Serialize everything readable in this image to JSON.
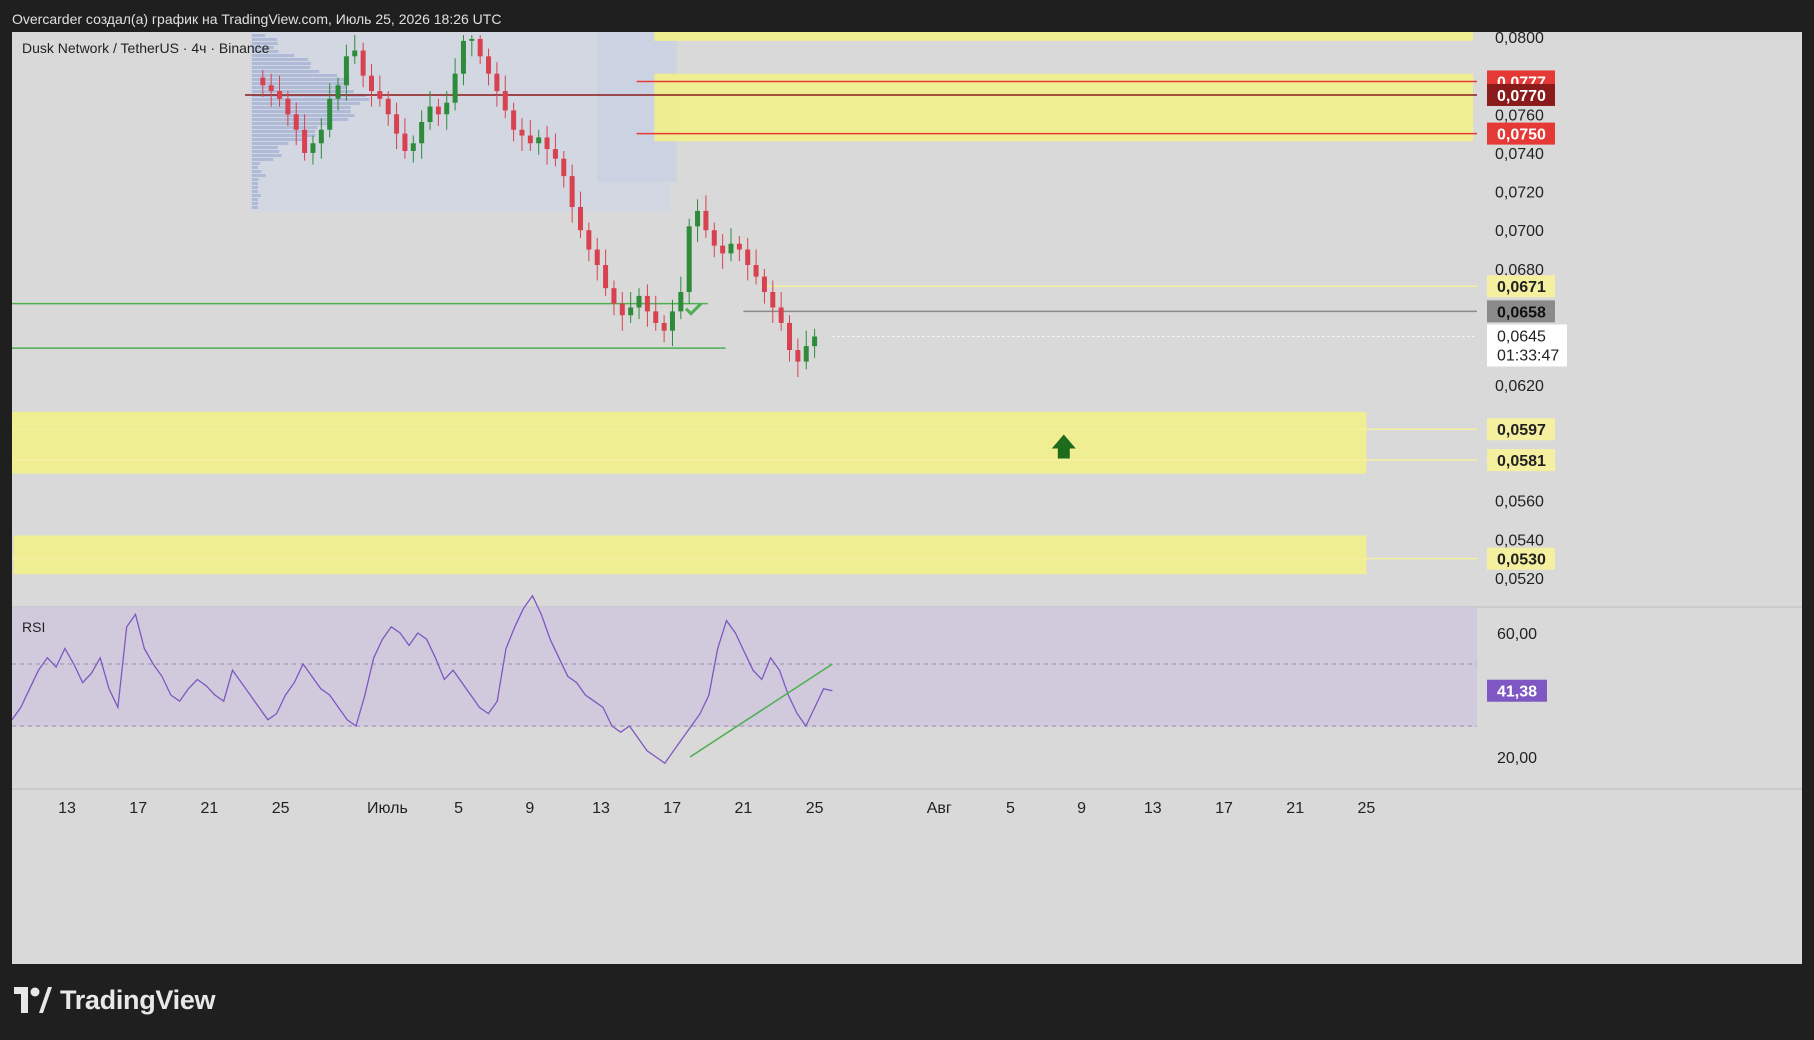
{
  "header": {
    "caption": "Overcarder создал(а) график на TradingView.com, Июль 25, 2026 18:26 UTC"
  },
  "symbol": {
    "title": "Dusk Network / TetherUS · 4ч · Binance"
  },
  "footer": {
    "brand": "TradingView"
  },
  "colors": {
    "background": "#1f1f1f",
    "chart_bg": "#d9d9d9",
    "zone": "#f2f08a",
    "up": "#2e8b3a",
    "down": "#d8414f",
    "rsi": "#7e57c2",
    "rsi_band": "#cfc8dc",
    "support_line": "#4caf50",
    "resistance_red": "#e53935",
    "resistance_dark": "#8b1a1a",
    "arrow": "#1e6b1e"
  },
  "icons": {
    "arrow": "arrow-up-icon",
    "check": "check-mark-icon",
    "logo": "tradingview-logo-icon"
  },
  "chart_data": {
    "type": "candlestick",
    "title": "Dusk Network / TetherUS · 4ч · Binance",
    "price_scale": {
      "ylim": [
        0.0508,
        0.0802
      ],
      "tick_labels": [
        "0,0800",
        "0,0760",
        "0,0740",
        "0,0720",
        "0,0700",
        "0,0680",
        "0,0620",
        "0,0560",
        "0,0540",
        "0,0520"
      ],
      "tick_values": [
        0.08,
        0.076,
        0.074,
        0.072,
        0.07,
        0.068,
        0.062,
        0.056,
        0.054,
        0.052
      ]
    },
    "time_axis": {
      "labels": [
        "13",
        "17",
        "21",
        "25",
        "Июль",
        "5",
        "9",
        "13",
        "17",
        "21",
        "25",
        "Авг",
        "5",
        "9",
        "13",
        "17",
        "21",
        "25"
      ]
    },
    "price_badges": [
      {
        "label": "0,0777",
        "value": 0.0777,
        "style": "red"
      },
      {
        "label": "0,0770",
        "value": 0.077,
        "style": "darkred"
      },
      {
        "label": "0,0750",
        "value": 0.075,
        "style": "red"
      },
      {
        "label": "0,0671",
        "value": 0.0671,
        "style": "yellow"
      },
      {
        "label": "0,0658",
        "value": 0.0658,
        "style": "gray"
      },
      {
        "label": "0,0597",
        "value": 0.0597,
        "style": "yellow"
      },
      {
        "label": "0,0581",
        "value": 0.0581,
        "style": "yellow"
      },
      {
        "label": "0,0530",
        "value": 0.053,
        "style": "yellow"
      }
    ],
    "last_price": {
      "label": "0,0645",
      "countdown": "01:33:47",
      "value": 0.0645
    },
    "zones": [
      {
        "name": "resistance-zone-top",
        "from": "2026-07-16",
        "to": "2026-08-31",
        "low": 0.0798,
        "high": 0.0803
      },
      {
        "name": "resistance-zone",
        "from": "2026-07-16",
        "to": "2026-08-31",
        "low": 0.0746,
        "high": 0.0781
      },
      {
        "name": "support-zone-upper",
        "from": "2026-06-09",
        "to": "2026-08-25",
        "low": 0.0574,
        "high": 0.0606
      },
      {
        "name": "support-zone-lower",
        "from": "2026-06-10",
        "to": "2026-08-25",
        "low": 0.0522,
        "high": 0.0542
      }
    ],
    "level_lines": [
      {
        "value": 0.0671,
        "color": "#f5f0a0",
        "from": "2026-07-22",
        "to": "end"
      },
      {
        "value": 0.0658,
        "color": "#8a8a8a",
        "from": "2026-07-21",
        "to": "end"
      },
      {
        "value": 0.0597,
        "color": "#f5f0a0",
        "from": "start",
        "to": "end"
      },
      {
        "value": 0.0581,
        "color": "#f5f0a0",
        "from": "start",
        "to": "end"
      },
      {
        "value": 0.053,
        "color": "#f5f0a0",
        "from": "start",
        "to": "end"
      },
      {
        "value": 0.077,
        "color": "#8b1a1a",
        "from": "2026-06-23",
        "to": "end"
      },
      {
        "value": 0.0777,
        "color": "#e53935",
        "from": "2026-07-15",
        "to": "end"
      },
      {
        "value": 0.075,
        "color": "#e53935",
        "from": "2026-07-15",
        "to": "end"
      }
    ],
    "support_lines": [
      {
        "value": 0.0662,
        "from": "start",
        "to": "2026-07-19"
      },
      {
        "value": 0.0639,
        "from": "start",
        "to": "2026-07-20"
      }
    ],
    "ohlc_4h": {
      "start": "2026-06-24",
      "end": "2026-07-25",
      "approx_closes": [
        0.0775,
        0.0772,
        0.0768,
        0.076,
        0.0752,
        0.074,
        0.0745,
        0.0752,
        0.0768,
        0.0775,
        0.079,
        0.0793,
        0.078,
        0.0772,
        0.0768,
        0.076,
        0.075,
        0.0741,
        0.0745,
        0.0756,
        0.0764,
        0.076,
        0.0766,
        0.0781,
        0.0798,
        0.0799,
        0.079,
        0.0781,
        0.0772,
        0.0762,
        0.0752,
        0.0749,
        0.0745,
        0.0748,
        0.0742,
        0.0737,
        0.0728,
        0.0712,
        0.07,
        0.069,
        0.0682,
        0.067,
        0.0662,
        0.0656,
        0.066,
        0.0666,
        0.0658,
        0.0652,
        0.0648,
        0.0658,
        0.0668,
        0.0702,
        0.071,
        0.07,
        0.0692,
        0.0688,
        0.0693,
        0.069,
        0.0682,
        0.0676,
        0.0668,
        0.066,
        0.0652,
        0.0638,
        0.0632,
        0.064,
        0.0645
      ],
      "highs_lows": {
        "peak_high": 0.0733,
        "peak_high_date": "2026-07-21",
        "low": 0.0626,
        "low_date": "2026-07-24"
      }
    },
    "rsi": {
      "label": "RSI",
      "current": "41,38",
      "current_value": 41.38,
      "ylim": [
        15,
        70
      ],
      "tick_labels": [
        "60,00",
        "20,00"
      ],
      "tick_values": [
        60,
        20
      ],
      "bands": [
        30,
        70
      ],
      "approx_values": [
        32,
        36,
        42,
        48,
        52,
        49,
        55,
        50,
        44,
        47,
        52,
        42,
        36,
        62,
        66,
        55,
        50,
        46,
        40,
        38,
        42,
        45,
        43,
        40,
        38,
        48,
        44,
        40,
        36,
        32,
        34,
        40,
        44,
        50,
        46,
        42,
        40,
        36,
        32,
        30,
        40,
        52,
        58,
        62,
        60,
        56,
        60,
        58,
        52,
        45,
        48,
        44,
        40,
        36,
        34,
        38,
        55,
        62,
        68,
        72,
        66,
        58,
        52,
        46,
        44,
        40,
        38,
        36,
        30,
        28,
        30,
        26,
        22,
        20,
        18,
        22,
        26,
        30,
        34,
        40,
        55,
        64,
        60,
        54,
        48,
        45,
        52,
        48,
        40,
        34,
        30,
        36,
        42,
        41.38
      ],
      "trendline": {
        "from": {
          "date": "2026-07-18",
          "value": 20
        },
        "to": {
          "date": "2026-07-26",
          "value": 50
        }
      }
    }
  }
}
